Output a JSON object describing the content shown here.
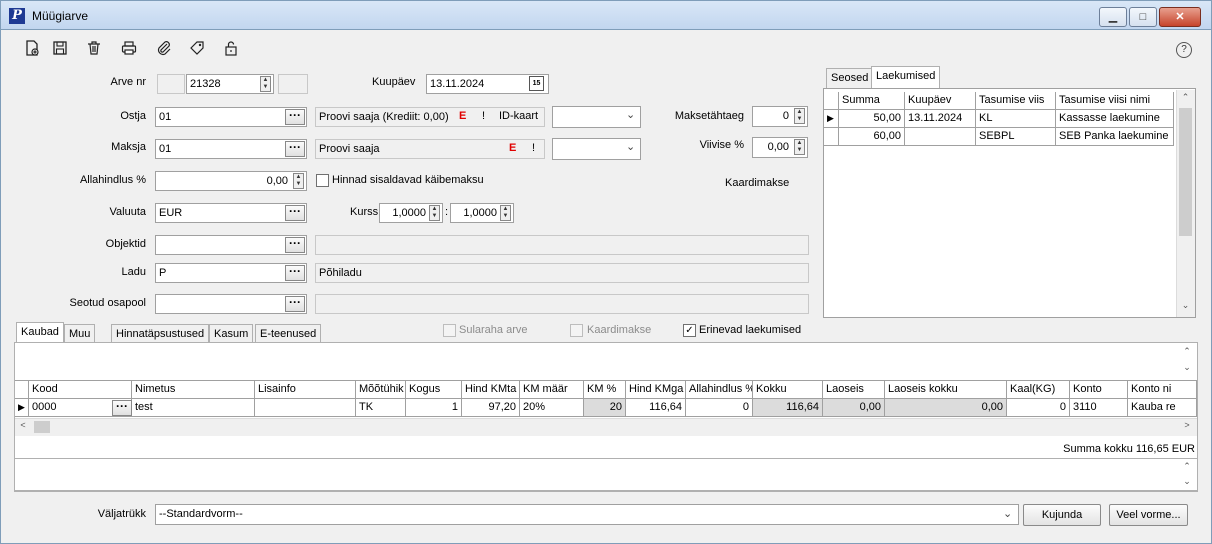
{
  "window": {
    "title": "Müügiarve"
  },
  "form": {
    "arve_nr_label": "Arve nr",
    "arve_nr": "21328",
    "kuupaev_label": "Kuupäev",
    "kuupaev": "13.11.2024",
    "calendar_glyph": "15",
    "ostja_label": "Ostja",
    "ostja": "01",
    "ostja_name": "Proovi saaja (Krediit: 0,00)",
    "ostja_e": "E",
    "ostja_excl": "!",
    "id_kaart_label": "ID-kaart",
    "maksetahtaeg_label": "Maksetähtaeg",
    "maksetahtaeg": "0",
    "maksja_label": "Maksja",
    "maksja": "01",
    "maksja_name": "Proovi saaja",
    "maksja_e": "E",
    "maksja_excl": "!",
    "viivise_label": "Viivise %",
    "viivise": "0,00",
    "allahindlus_label": "Allahindlus %",
    "allahindlus": "0,00",
    "hinnad_km_label": "Hinnad sisaldavad käibemaksu",
    "kaardimakse_info": "Kaardimakse",
    "valuuta_label": "Valuuta",
    "valuuta": "EUR",
    "kurss_label": "Kurss",
    "kurss1": "1,0000",
    "kurss_sep": ":",
    "kurss2": "1,0000",
    "objektid_label": "Objektid",
    "ladu_label": "Ladu",
    "ladu": "P",
    "ladu_name": "Põhiladu",
    "seotud_label": "Seotud osapool"
  },
  "right_tabs": [
    "Seosed",
    "Laekumised"
  ],
  "payments": {
    "columns": [
      "Summa",
      "Kuupäev",
      "Tasumise viis",
      "Tasumise viisi nimi"
    ],
    "rows": [
      [
        "50,00",
        "13.11.2024",
        "KL",
        "Kassasse laekumine"
      ],
      [
        "60,00",
        "",
        "SEBPL",
        "SEB Panka laekumine"
      ]
    ]
  },
  "bottom_tabs": [
    "Kaubad",
    "Muu",
    "Hinnatäpsustused",
    "Kasum",
    "E-teenused"
  ],
  "options": {
    "sularaha": "Sularaha arve",
    "kaardimakse": "Kaardimakse",
    "erinevad": "Erinevad laekumised",
    "check_glyph": "✓"
  },
  "items": {
    "columns": [
      "Kood",
      "Nimetus",
      "Lisainfo",
      "Mõõtühik",
      "Kogus",
      "Hind KMta",
      "KM määr",
      "KM %",
      "Hind KMga",
      "Allahindlus %",
      "Kokku",
      "Laoseis",
      "Laoseis kokku",
      "Kaal(KG)",
      "Konto",
      "Konto ni"
    ],
    "rows": [
      [
        "0000",
        "test",
        "",
        "TK",
        "1",
        "97,20",
        "20%",
        "20",
        "116,64",
        "0",
        "116,64",
        "0,00",
        "0,00",
        "0",
        "3110",
        "Kauba re"
      ]
    ]
  },
  "summa_kokku": "Summa kokku 116,65 EUR",
  "footer": {
    "valjatrykk_label": "Väljatrükk",
    "valjatrykk": "--Standardvorm--",
    "kujunda": "Kujunda",
    "veel_vorme": "Veel vorme..."
  },
  "icons": {
    "help": "?",
    "row_pointer": "▶",
    "scroll_up": "⌃",
    "scroll_down": "⌄",
    "scroll_left": "<",
    "scroll_right": ">",
    "dropdown": "⌄",
    "dots": "···",
    "spin_up": "▲",
    "spin_down": "▼",
    "minimize": "▁",
    "maximize": "□",
    "close": "✕"
  },
  "colors": {
    "accent": "#1f3a93",
    "danger": "#e00000"
  }
}
